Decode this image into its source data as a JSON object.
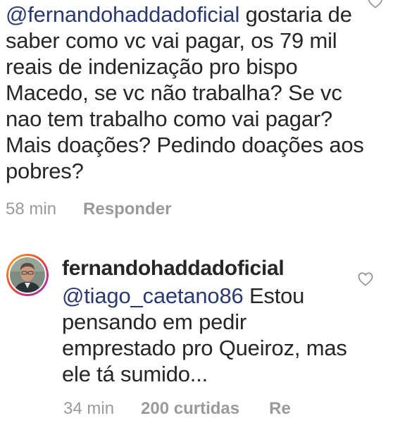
{
  "comment1": {
    "mention": "@fernandohaddadoficial",
    "text": " gostaria de saber como vc vai pagar, os 79 mil reais de indenização pro bispo Macedo, se vc não trabalha? Se vc nao tem trabalho como vai pagar? Mais doações? Pedindo doações aos pobres?",
    "time": "58 min",
    "reply_label": "Responder",
    "like_icon": "heart-outline-icon"
  },
  "comment2": {
    "username": "fernandohaddadoficial",
    "mention": "@tiago_caetano86",
    "text": " Estou pensando em pedir emprestado pro Queiroz, mas ele tá sumido...",
    "time": "34 min",
    "likes": "200 curtidas",
    "reply_label": "Re",
    "like_icon": "heart-outline-icon",
    "avatar": "profile-avatar"
  },
  "colors": {
    "text": "#262626",
    "mention": "#2a3a6e",
    "meta": "#9a9a9a",
    "story_ring_start": "#f5b02e",
    "story_ring_end": "#7a3fc2"
  }
}
